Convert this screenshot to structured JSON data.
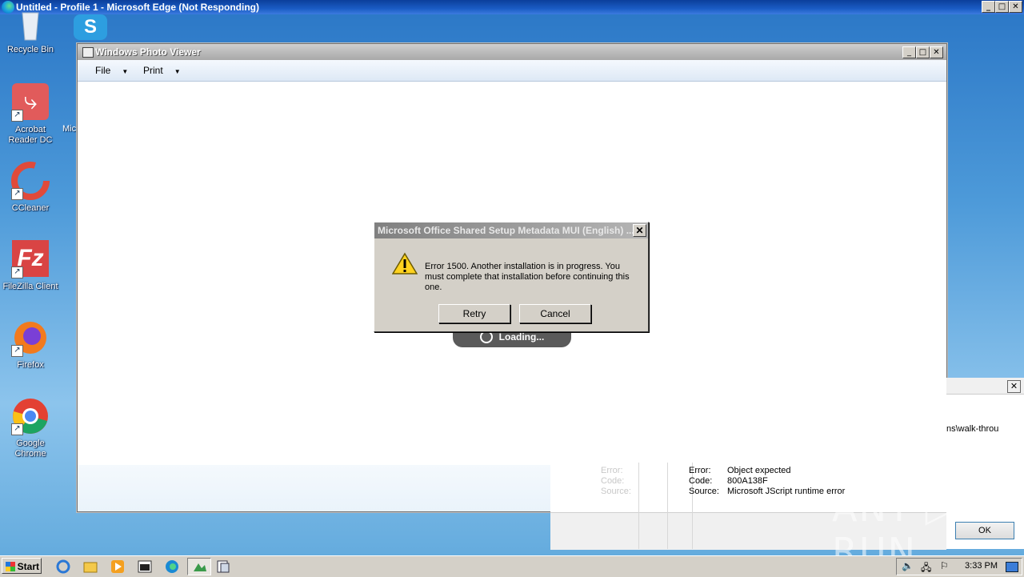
{
  "browser_window": {
    "title": "Untitled - Profile 1 - Microsoft Edge (Not Responding)",
    "controls": {
      "minimize": "_",
      "maximize": "□",
      "close": "✕"
    }
  },
  "desktop": {
    "icons": [
      {
        "label": "Recycle Bin",
        "icon": "recycle-bin-icon"
      },
      {
        "label": "Acrobat Reader DC",
        "icon": "acrobat-icon"
      },
      {
        "label": "CCleaner",
        "icon": "ccleaner-icon"
      },
      {
        "label": "FileZilla Client",
        "icon": "filezilla-icon"
      },
      {
        "label": "Firefox",
        "icon": "firefox-icon"
      },
      {
        "label": "Google Chrome",
        "icon": "chrome-icon"
      }
    ],
    "partial_label": "Micr"
  },
  "photo_viewer": {
    "title": "Windows Photo Viewer",
    "menu": {
      "file": "File",
      "print": "Print"
    },
    "loading": "Loading..."
  },
  "error_dialog": {
    "title": "Microsoft Office Shared Setup Metadata MUI (English) ...",
    "message": "Error 1500. Another installation is in progress.  You must complete that installation before continuing this one.",
    "retry": "Retry",
    "cancel": "Cancel",
    "close": "✕"
  },
  "script_error": {
    "path_fragment": "ns\\walk-throu",
    "faint_labels": {
      "error": "Error:",
      "code": "Code:",
      "source": "Source:"
    },
    "labels": {
      "error": "Error:",
      "code": "Code:",
      "source": "Source:"
    },
    "values": {
      "error": "Object expected",
      "code": "800A138F",
      "source": "Microsoft JScript runtime error"
    },
    "ok": "OK",
    "close": "✕"
  },
  "watermark": "ANY ▷ RUN",
  "taskbar": {
    "start": "Start",
    "clock": "3:33 PM"
  }
}
